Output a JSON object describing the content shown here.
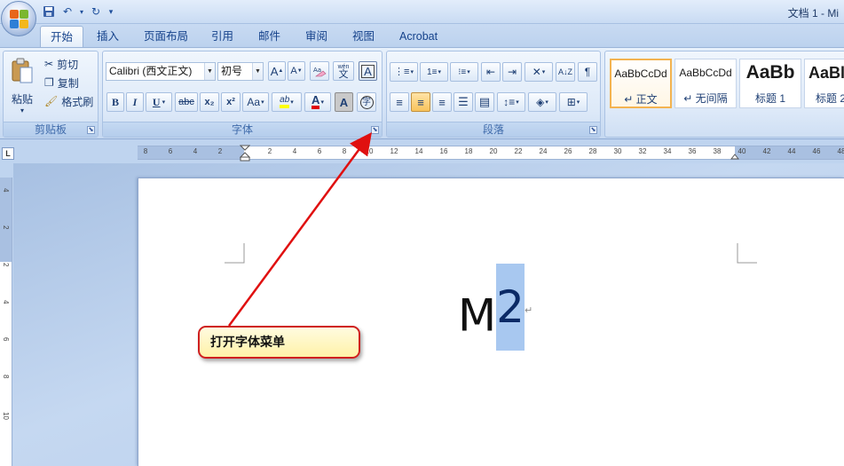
{
  "window": {
    "title": "文档 1 - Mi"
  },
  "qat": {
    "save": "save-icon",
    "undo": "↶",
    "redo": "↻",
    "customize": "▾"
  },
  "tabs": [
    "开始",
    "插入",
    "页面布局",
    "引用",
    "邮件",
    "审阅",
    "视图",
    "Acrobat"
  ],
  "clipboard": {
    "paste_label": "粘贴",
    "cut_label": "剪切",
    "copy_label": "复制",
    "painter_label": "格式刷",
    "group_label": "剪贴板"
  },
  "font": {
    "name": "Calibri (西文正文)",
    "size": "初号",
    "grow": "A",
    "shrink": "A",
    "phonetic": "wén",
    "char_border": "A",
    "bold": "B",
    "italic": "I",
    "underline": "U",
    "strike": "abc",
    "subscript": "x₂",
    "superscript": "x²",
    "case": "Aa",
    "highlight": "ab",
    "color": "A",
    "shading": "A",
    "enclose": "字",
    "group_label": "字体",
    "highlight_color": "#ffff00",
    "font_color": "#e00000"
  },
  "paragraph": {
    "group_label": "段落"
  },
  "styles": [
    {
      "sample": "AaBbCcDd",
      "name": "↵ 正文"
    },
    {
      "sample": "AaBbCcDd",
      "name": "↵ 无间隔"
    },
    {
      "sample": "AaBb",
      "name": "标题 1"
    },
    {
      "sample": "AaBl",
      "name": "标题 2"
    }
  ],
  "ruler": {
    "left_numbers": [
      "8",
      "6",
      "4",
      "2"
    ],
    "right_numbers": [
      "2",
      "4",
      "6",
      "8",
      "10",
      "12",
      "14",
      "16",
      "18",
      "20",
      "22",
      "24",
      "26",
      "28",
      "30",
      "32",
      "34",
      "36",
      "38",
      "40",
      "42",
      "44",
      "46",
      "48"
    ],
    "vertical_numbers": [
      "4",
      "2",
      "2",
      "4",
      "6",
      "8",
      "10"
    ],
    "corner": "L"
  },
  "document": {
    "text_plain": "M",
    "text_selected": "2",
    "para_mark": "↵"
  },
  "annotation": {
    "callout_text": "打开字体菜单",
    "color": "#e01010"
  }
}
